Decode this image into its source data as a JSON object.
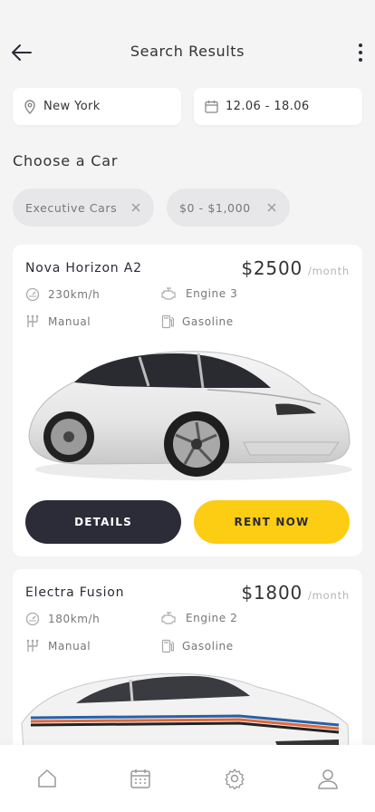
{
  "header": {
    "title": "Search Results"
  },
  "search": {
    "location": "New York",
    "dates": "12.06 - 18.06"
  },
  "section_title": "Choose a Car",
  "filters": [
    {
      "label": "Executive Cars"
    },
    {
      "label": "$0 - $1,000"
    }
  ],
  "cars": [
    {
      "name": "Nova Horizon A2",
      "price": "$2500",
      "unit": "/month",
      "speed": "230km/h",
      "engine": "Engine 3",
      "transmission": "Manual",
      "fuel": "Gasoline",
      "details_label": "DETAILS",
      "rent_label": "RENT NOW"
    },
    {
      "name": "Electra Fusion",
      "price": "$1800",
      "unit": "/month",
      "speed": "180km/h",
      "engine": "Engine 2",
      "transmission": "Manual",
      "fuel": "Gasoline"
    }
  ],
  "colors": {
    "dark": "#2c2b38",
    "accent": "#fccd12",
    "background": "#f4f4f4"
  },
  "tabs": [
    "home-icon",
    "calendar-icon",
    "settings-icon",
    "profile-icon"
  ]
}
